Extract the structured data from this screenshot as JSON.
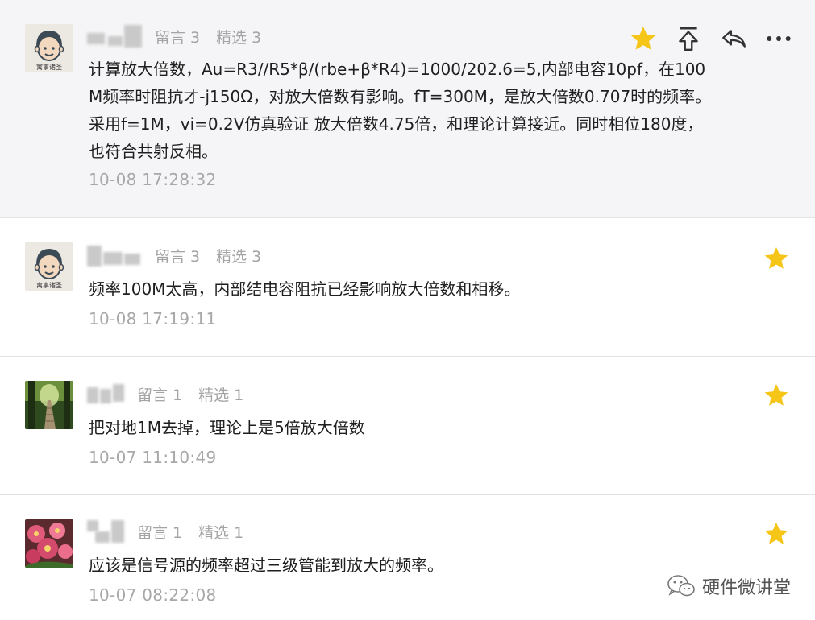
{
  "comments": [
    {
      "stats": {
        "messages": "留言 3",
        "selected": "精选 3"
      },
      "text": "计算放大倍数，Au=R3//R5*β/(rbe+β*R4)=1000/202.6=5,内部电容10pf，在100M频率时阻抗才-j150Ω，对放大倍数有影响。fT=300M，是放大倍数0.707时的频率。采用f=1M，vi=0.2V仿真验证 放大倍数4.75倍，和理论计算接近。同时相位180度，也符合共射反相。",
      "time": "10-08 17:28:32",
      "avatar": "cartoon-face-avatar",
      "avatar_caption": "寓事诸圣",
      "starred": true
    },
    {
      "stats": {
        "messages": "留言 3",
        "selected": "精选 3"
      },
      "text": "频率100M太高，内部结电容阻抗已经影响放大倍数和相移。",
      "time": "10-08 17:19:11",
      "avatar": "cartoon-face-avatar",
      "avatar_caption": "寓事诸圣",
      "starred": true
    },
    {
      "stats": {
        "messages": "留言 1",
        "selected": "精选 1"
      },
      "text": "把对地1M去掉，理论上是5倍放大倍数",
      "time": "10-07 11:10:49",
      "avatar": "forest-path-avatar",
      "starred": true
    },
    {
      "stats": {
        "messages": "留言 1",
        "selected": "精选 1"
      },
      "text": "应该是信号源的频率超过三级管能到放大的频率。",
      "time": "10-07 08:22:08",
      "avatar": "flowers-avatar",
      "starred": true
    }
  ],
  "watermark": {
    "label": "硬件微讲堂",
    "icon": "wechat-icon"
  },
  "colors": {
    "star": "#f5c518",
    "meta": "#a4a4a4",
    "time": "#a8a8a8",
    "highlight_bg": "#f5f5f7"
  }
}
